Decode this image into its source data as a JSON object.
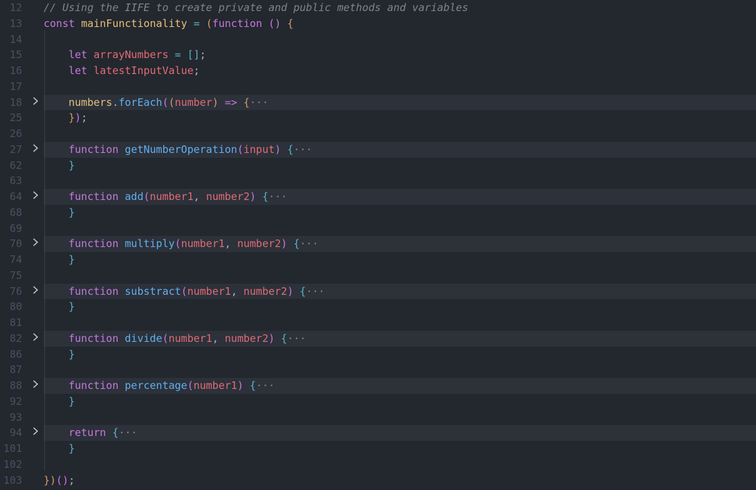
{
  "theme_colors": {
    "background": "#23272e",
    "folded_line_bg": "#2c313a",
    "line_number": "#495162",
    "comment": "#7f848e",
    "keyword": "#c678dd",
    "function": "#61afef",
    "variable": "#e06c75",
    "declaration": "#e5c07b",
    "bracket_gold": "#d19a66",
    "bracket_cyan": "#56b6c2",
    "plain": "#abb2bf"
  },
  "lines": [
    {
      "num": "12",
      "fold": false,
      "folded": false,
      "tokens": [
        {
          "t": "// Using the IIFE to create private and public methods and variables",
          "c": "#7f848e",
          "i": true
        }
      ]
    },
    {
      "num": "13",
      "fold": false,
      "folded": false,
      "tokens": [
        {
          "t": "const ",
          "c": "#c678dd"
        },
        {
          "t": "mainFunctionality",
          "c": "#e5c07b"
        },
        {
          "t": " = ",
          "c": "#56b6c2"
        },
        {
          "t": "(",
          "c": "#d19a66"
        },
        {
          "t": "function ",
          "c": "#c678dd"
        },
        {
          "t": "()",
          "c": "#c678dd"
        },
        {
          "t": " {",
          "c": "#d19a66"
        }
      ]
    },
    {
      "num": "14",
      "fold": false,
      "folded": false,
      "tokens": []
    },
    {
      "num": "15",
      "fold": false,
      "folded": false,
      "tokens": [
        {
          "t": "    let ",
          "c": "#c678dd"
        },
        {
          "t": "arrayNumbers",
          "c": "#e06c75"
        },
        {
          "t": " = ",
          "c": "#56b6c2"
        },
        {
          "t": "[]",
          "c": "#56b6c2"
        },
        {
          "t": ";",
          "c": "#abb2bf"
        }
      ]
    },
    {
      "num": "16",
      "fold": false,
      "folded": false,
      "tokens": [
        {
          "t": "    let ",
          "c": "#c678dd"
        },
        {
          "t": "latestInputValue",
          "c": "#e06c75"
        },
        {
          "t": ";",
          "c": "#abb2bf"
        }
      ]
    },
    {
      "num": "17",
      "fold": false,
      "folded": false,
      "tokens": []
    },
    {
      "num": "18",
      "fold": true,
      "folded": true,
      "tokens": [
        {
          "t": "    numbers",
          "c": "#e5c07b"
        },
        {
          "t": ".",
          "c": "#abb2bf"
        },
        {
          "t": "forEach",
          "c": "#61afef"
        },
        {
          "t": "(",
          "c": "#c678dd"
        },
        {
          "t": "(",
          "c": "#d19a66"
        },
        {
          "t": "number",
          "c": "#e06c75"
        },
        {
          "t": ")",
          "c": "#d19a66"
        },
        {
          "t": " => ",
          "c": "#c678dd"
        },
        {
          "t": "{",
          "c": "#d19a66"
        },
        {
          "t": "···",
          "c": "#7f848e"
        }
      ]
    },
    {
      "num": "25",
      "fold": false,
      "folded": false,
      "tokens": [
        {
          "t": "    }",
          "c": "#d19a66"
        },
        {
          "t": ")",
          "c": "#c678dd"
        },
        {
          "t": ";",
          "c": "#abb2bf"
        }
      ]
    },
    {
      "num": "26",
      "fold": false,
      "folded": false,
      "tokens": []
    },
    {
      "num": "27",
      "fold": true,
      "folded": true,
      "tokens": [
        {
          "t": "    function ",
          "c": "#c678dd"
        },
        {
          "t": "getNumberOperation",
          "c": "#61afef"
        },
        {
          "t": "(",
          "c": "#c678dd"
        },
        {
          "t": "input",
          "c": "#e06c75"
        },
        {
          "t": ")",
          "c": "#c678dd"
        },
        {
          "t": " {",
          "c": "#56b6c2"
        },
        {
          "t": "···",
          "c": "#7f848e"
        }
      ]
    },
    {
      "num": "62",
      "fold": false,
      "folded": false,
      "tokens": [
        {
          "t": "    }",
          "c": "#56b6c2"
        }
      ]
    },
    {
      "num": "63",
      "fold": false,
      "folded": false,
      "tokens": []
    },
    {
      "num": "64",
      "fold": true,
      "folded": true,
      "tokens": [
        {
          "t": "    function ",
          "c": "#c678dd"
        },
        {
          "t": "add",
          "c": "#61afef"
        },
        {
          "t": "(",
          "c": "#c678dd"
        },
        {
          "t": "number1",
          "c": "#e06c75"
        },
        {
          "t": ", ",
          "c": "#abb2bf"
        },
        {
          "t": "number2",
          "c": "#e06c75"
        },
        {
          "t": ")",
          "c": "#c678dd"
        },
        {
          "t": " {",
          "c": "#56b6c2"
        },
        {
          "t": "···",
          "c": "#7f848e"
        }
      ]
    },
    {
      "num": "68",
      "fold": false,
      "folded": false,
      "tokens": [
        {
          "t": "    }",
          "c": "#56b6c2"
        }
      ]
    },
    {
      "num": "69",
      "fold": false,
      "folded": false,
      "tokens": []
    },
    {
      "num": "70",
      "fold": true,
      "folded": true,
      "tokens": [
        {
          "t": "    function ",
          "c": "#c678dd"
        },
        {
          "t": "multiply",
          "c": "#61afef"
        },
        {
          "t": "(",
          "c": "#c678dd"
        },
        {
          "t": "number1",
          "c": "#e06c75"
        },
        {
          "t": ", ",
          "c": "#abb2bf"
        },
        {
          "t": "number2",
          "c": "#e06c75"
        },
        {
          "t": ")",
          "c": "#c678dd"
        },
        {
          "t": " {",
          "c": "#56b6c2"
        },
        {
          "t": "···",
          "c": "#7f848e"
        }
      ]
    },
    {
      "num": "74",
      "fold": false,
      "folded": false,
      "tokens": [
        {
          "t": "    }",
          "c": "#56b6c2"
        }
      ]
    },
    {
      "num": "75",
      "fold": false,
      "folded": false,
      "tokens": []
    },
    {
      "num": "76",
      "fold": true,
      "folded": true,
      "tokens": [
        {
          "t": "    function ",
          "c": "#c678dd"
        },
        {
          "t": "substract",
          "c": "#61afef"
        },
        {
          "t": "(",
          "c": "#c678dd"
        },
        {
          "t": "number1",
          "c": "#e06c75"
        },
        {
          "t": ", ",
          "c": "#abb2bf"
        },
        {
          "t": "number2",
          "c": "#e06c75"
        },
        {
          "t": ")",
          "c": "#c678dd"
        },
        {
          "t": " {",
          "c": "#56b6c2"
        },
        {
          "t": "···",
          "c": "#7f848e"
        }
      ]
    },
    {
      "num": "80",
      "fold": false,
      "folded": false,
      "tokens": [
        {
          "t": "    }",
          "c": "#56b6c2"
        }
      ]
    },
    {
      "num": "81",
      "fold": false,
      "folded": false,
      "tokens": []
    },
    {
      "num": "82",
      "fold": true,
      "folded": true,
      "tokens": [
        {
          "t": "    function ",
          "c": "#c678dd"
        },
        {
          "t": "divide",
          "c": "#61afef"
        },
        {
          "t": "(",
          "c": "#c678dd"
        },
        {
          "t": "number1",
          "c": "#e06c75"
        },
        {
          "t": ", ",
          "c": "#abb2bf"
        },
        {
          "t": "number2",
          "c": "#e06c75"
        },
        {
          "t": ")",
          "c": "#c678dd"
        },
        {
          "t": " {",
          "c": "#56b6c2"
        },
        {
          "t": "···",
          "c": "#7f848e"
        }
      ]
    },
    {
      "num": "86",
      "fold": false,
      "folded": false,
      "tokens": [
        {
          "t": "    }",
          "c": "#56b6c2"
        }
      ]
    },
    {
      "num": "87",
      "fold": false,
      "folded": false,
      "tokens": []
    },
    {
      "num": "88",
      "fold": true,
      "folded": true,
      "tokens": [
        {
          "t": "    function ",
          "c": "#c678dd"
        },
        {
          "t": "percentage",
          "c": "#61afef"
        },
        {
          "t": "(",
          "c": "#c678dd"
        },
        {
          "t": "number1",
          "c": "#e06c75"
        },
        {
          "t": ")",
          "c": "#c678dd"
        },
        {
          "t": " {",
          "c": "#56b6c2"
        },
        {
          "t": "···",
          "c": "#7f848e"
        }
      ]
    },
    {
      "num": "92",
      "fold": false,
      "folded": false,
      "tokens": [
        {
          "t": "    }",
          "c": "#56b6c2"
        }
      ]
    },
    {
      "num": "93",
      "fold": false,
      "folded": false,
      "tokens": []
    },
    {
      "num": "94",
      "fold": true,
      "folded": true,
      "tokens": [
        {
          "t": "    return ",
          "c": "#c678dd"
        },
        {
          "t": "{",
          "c": "#56b6c2"
        },
        {
          "t": "···",
          "c": "#7f848e"
        }
      ]
    },
    {
      "num": "101",
      "fold": false,
      "folded": false,
      "tokens": [
        {
          "t": "    }",
          "c": "#56b6c2"
        }
      ]
    },
    {
      "num": "102",
      "fold": false,
      "folded": false,
      "tokens": []
    },
    {
      "num": "103",
      "fold": false,
      "folded": false,
      "tokens": [
        {
          "t": "}",
          "c": "#d19a66"
        },
        {
          "t": ")",
          "c": "#d19a66"
        },
        {
          "t": "()",
          "c": "#c678dd"
        },
        {
          "t": ";",
          "c": "#abb2bf"
        }
      ]
    }
  ]
}
